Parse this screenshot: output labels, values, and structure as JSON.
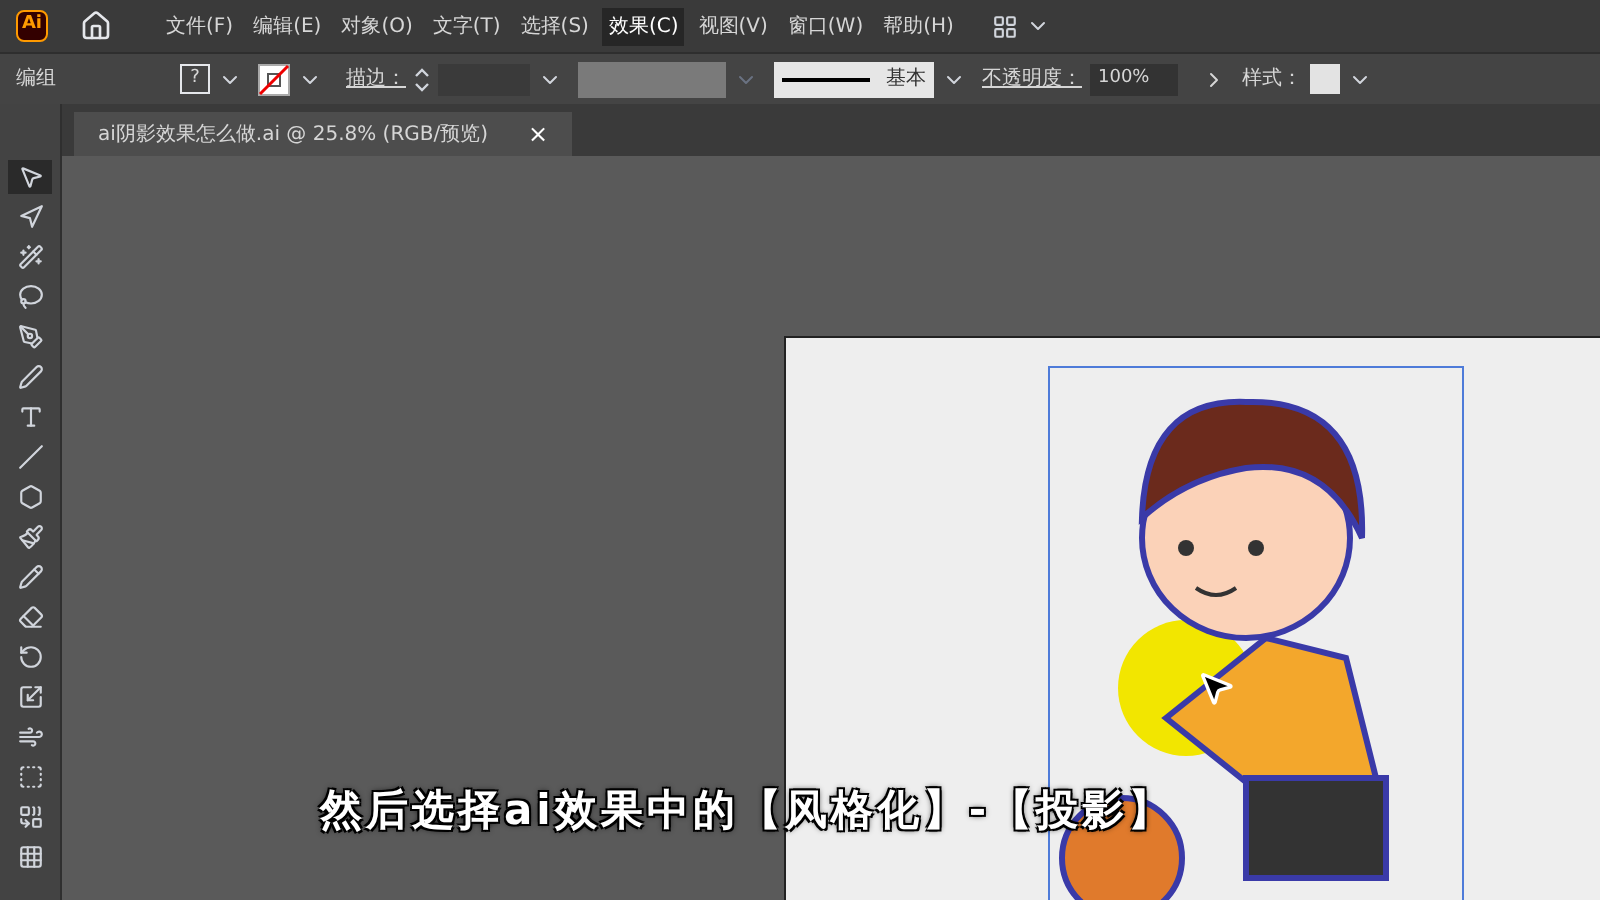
{
  "app_icon": "Ai",
  "menu_bar": [
    {
      "label": "文件(F)",
      "selected": false
    },
    {
      "label": "编辑(E)",
      "selected": false
    },
    {
      "label": "对象(O)",
      "selected": false
    },
    {
      "label": "文字(T)",
      "selected": false
    },
    {
      "label": "选择(S)",
      "selected": false
    },
    {
      "label": "效果(C)",
      "selected": true
    },
    {
      "label": "视图(V)",
      "selected": false
    },
    {
      "label": "窗口(W)",
      "selected": false
    },
    {
      "label": "帮助(H)",
      "selected": false
    }
  ],
  "control_bar": {
    "selection_label": "编组",
    "fill_swatch": "?",
    "stroke_label": "描边：",
    "stroke_profile": "基本",
    "opacity_label": "不透明度：",
    "opacity_value": "100%",
    "style_label": "样式："
  },
  "document_tab": {
    "title": "ai阴影效果怎么做.ai @ 25.8% (RGB/预览)",
    "close": "×"
  },
  "tools": [
    {
      "kind": "selection",
      "selected": true
    },
    {
      "kind": "direct",
      "selected": false
    },
    {
      "kind": "wand",
      "selected": false
    },
    {
      "kind": "lasso",
      "selected": false
    },
    {
      "kind": "pen",
      "selected": false
    },
    {
      "kind": "curvature",
      "selected": false
    },
    {
      "kind": "type",
      "selected": false
    },
    {
      "kind": "line",
      "selected": false
    },
    {
      "kind": "polygon",
      "selected": false
    },
    {
      "kind": "brush",
      "selected": false
    },
    {
      "kind": "shaper",
      "selected": false
    },
    {
      "kind": "eraser",
      "selected": false
    },
    {
      "kind": "rotate",
      "selected": false
    },
    {
      "kind": "scale",
      "selected": false
    },
    {
      "kind": "warp",
      "selected": false
    },
    {
      "kind": "transform",
      "selected": false
    },
    {
      "kind": "builder",
      "selected": false
    },
    {
      "kind": "grid",
      "selected": false
    }
  ],
  "subtitle": "然后选择ai效果中的【风格化】-【投影】"
}
